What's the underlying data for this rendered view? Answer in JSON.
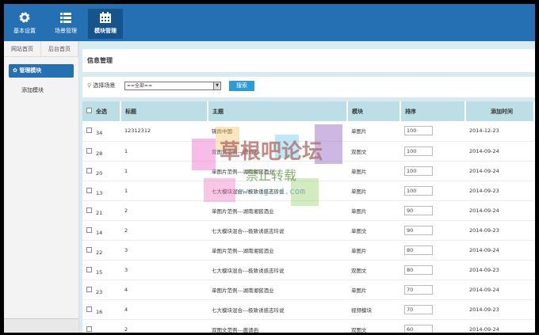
{
  "top_nav": [
    {
      "label": "基本设置",
      "icon": "gear-icon"
    },
    {
      "label": "场景管理",
      "icon": "list-icon"
    },
    {
      "label": "模块管理",
      "icon": "calendar-icon",
      "active": true
    }
  ],
  "sidebar": {
    "tabs": [
      "网站首页",
      "后台首页"
    ],
    "active_item": "管理模块",
    "items": [
      "添加模块"
    ]
  },
  "page_title": "信息管理",
  "search": {
    "label": "选择场景",
    "select_value": "==全部==",
    "button": "搜索"
  },
  "table": {
    "headers": [
      "全选",
      "标题",
      "主题",
      "模块",
      "排序",
      "添加时间"
    ],
    "rows": [
      [
        "34",
        "12312312",
        "锦尚中国",
        "单图片",
        "100",
        "2014-12-23"
      ],
      [
        "28",
        "1",
        "双图文范例---邀请函",
        "双图文",
        "100",
        "2014-09-24"
      ],
      [
        "20",
        "1",
        "单图片范例---湖南湘窖酒业",
        "单图片",
        "100",
        "2014-09-24"
      ],
      [
        "13",
        "1",
        "七大模块混合---极致诱惑志玲说",
        "单图片",
        "100",
        "2014-09-23"
      ],
      [
        "21",
        "2",
        "单图片范例---湖南湘窖酒业",
        "单图片",
        "90",
        "2014-09-24"
      ],
      [
        "14",
        "2",
        "七大模块混合---极致诱惑志玲说",
        "单图文",
        "90",
        "2014-09-23"
      ],
      [
        "22",
        "3",
        "单图片范例---湖南湘窖酒业",
        "单图片",
        "80",
        "2014-09-24"
      ],
      [
        "15",
        "3",
        "七大模块混合---极致诱惑志玲说",
        "双图文",
        "80",
        "2014-09-23"
      ],
      [
        "23",
        "4",
        "单图片范例---湖南湘窖酒业",
        "单图片",
        "70",
        "2014-09-24"
      ],
      [
        "16",
        "4",
        "七大模块混合---极致诱惑志玲说",
        "视频模块",
        "70",
        "2014-09-23"
      ],
      [
        "",
        "2",
        "双图文范例---邀请函",
        "双图文",
        "60",
        "2014-09-24"
      ]
    ]
  },
  "watermark": {
    "line1": "草根吧论坛",
    "line2": "禁止转载",
    "line3": "www.cgzzd.com"
  }
}
